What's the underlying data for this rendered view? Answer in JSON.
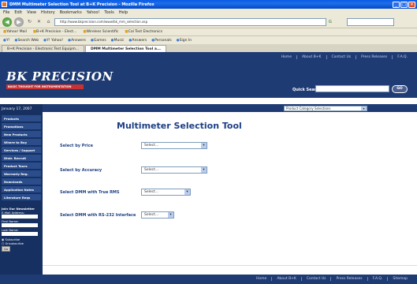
{
  "window": {
    "title": "DMM Multimeter Selection Tool at B+K Precision - Mozilla Firefox"
  },
  "menu": [
    "File",
    "Edit",
    "View",
    "History",
    "Bookmarks",
    "Yahoo!",
    "Tools",
    "Help"
  ],
  "navigation": {
    "address": "http://www.bkprecision.com/www/bk_mm_selection.asp",
    "go_label": "G"
  },
  "bookmarks": [
    "Yahoo! Mail",
    "B+K Precision - Elect...",
    "Wireless Scientific",
    "Cal Test Electronics"
  ],
  "toolbar2": [
    "Y!",
    "Search Web",
    "Y! Yahoo!",
    "Answers",
    "Games",
    "Music",
    "Answers",
    "Personals",
    "Sign In"
  ],
  "tabs": [
    {
      "label": "B+K Precision - Electronic Test Equipm...",
      "active": false
    },
    {
      "label": "DMM Multimeter Selection Tool a...",
      "active": true
    }
  ],
  "header": {
    "top_links": [
      "Home",
      "About B+K",
      "Contact Us",
      "Press Releases",
      "F.A.Q."
    ],
    "logo": "BK PRECISION",
    "tagline": "BASIC THOUGHT FOR INSTRUMENTATION",
    "quick_search_label": "Quick Search",
    "go_label": "GO"
  },
  "sidebar": {
    "date": "January 17, 2007",
    "items": [
      "Products",
      "Promotions",
      "New Products",
      "Where to Buy",
      "Services / Support",
      "Distr. Recruit",
      "Product Tours",
      "Warranty Reg.",
      "Downloads",
      "Application Notes",
      "Literature Reqs"
    ],
    "newsletter": {
      "title": "Join Our Newsletter",
      "email": "E-Mail Address:",
      "first": "First Name:",
      "last": "Last Name:",
      "subscribe": "Subscribe",
      "unsubscribe": "Unsubscribe",
      "go": "Go"
    }
  },
  "content": {
    "category_select": "Product Category Selections",
    "title": "Multimeter Selection Tool",
    "fields": [
      {
        "label": "Select by Price",
        "value": "Select..."
      },
      {
        "label": "Select by Accuracy",
        "value": "Select..."
      },
      {
        "label": "Select DMM with True RMS",
        "value": "Select..."
      },
      {
        "label": "Select DMM with RS-232 Interface",
        "value": "Select..."
      }
    ]
  },
  "footer": {
    "links": [
      "Home",
      "About B+K",
      "Contact Us",
      "Press Releases",
      "F.A.Q.",
      "Sitemap"
    ]
  },
  "colors": {
    "brand_navy": "#1f3b73",
    "title_blue": "#1c3f85",
    "tagline_red": "#c83232",
    "sidebar_item": "#2b4d8c"
  }
}
